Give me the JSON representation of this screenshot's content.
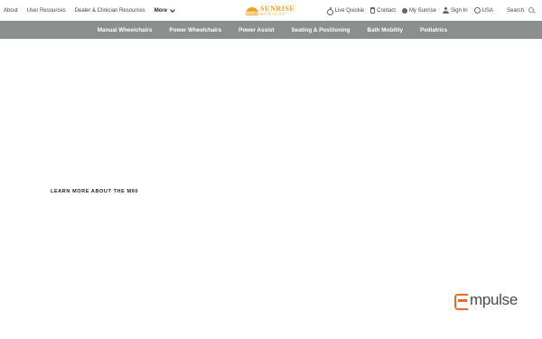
{
  "topbar": {
    "left_links": [
      "About",
      "User Resources",
      "Dealer & Clinician Resources"
    ],
    "more_label": "More",
    "logo": {
      "word": "SUNRISE",
      "sub": "MEDICAL"
    },
    "right": {
      "live_quickie": "Live Quickie",
      "contact": "Contact",
      "my_sunrise": "My Sunrise",
      "sign_in": "Sign In",
      "region": "USA",
      "search": "Search"
    }
  },
  "nav": {
    "items": [
      "Manual Wheelchairs",
      "Power Wheelchairs",
      "Power Assist",
      "Seating & Positioning",
      "Bath Mobility",
      "Pediatrics"
    ]
  },
  "hero": {
    "learn_more": "LEARN MORE ABOUT THE M90",
    "brand_logo": "mpulse"
  },
  "colors": {
    "nav_bg": "#8c8f8f",
    "logo": "#f0a21c",
    "brand_accent": "#e86a2a"
  },
  "icons": [
    "wheelchair-icon",
    "phone-icon",
    "globe-icon",
    "user-icon",
    "globe-outline-icon",
    "search-icon",
    "chevron-down-icon"
  ]
}
